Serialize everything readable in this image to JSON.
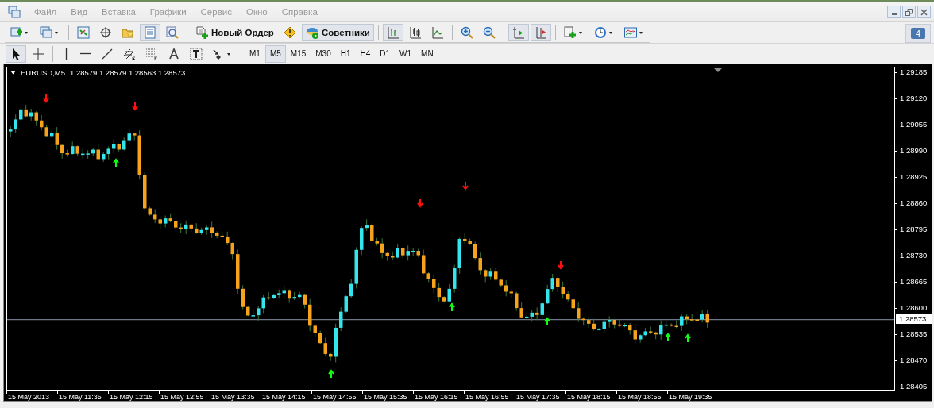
{
  "menu": [
    {
      "label": "Файл"
    },
    {
      "label": "Вид"
    },
    {
      "label": "Вставка"
    },
    {
      "label": "Графики"
    },
    {
      "label": "Сервис"
    },
    {
      "label": "Окно"
    },
    {
      "label": "Справка"
    }
  ],
  "notification_badge": {
    "count": "4"
  },
  "toolbar_main": [
    {
      "kind": "icon",
      "pressed": false
    },
    {
      "kind": "icon",
      "pressed": false
    },
    {
      "kind": "icon",
      "pressed": false
    },
    {
      "kind": "icon",
      "pressed": false
    },
    {
      "kind": "icon",
      "pressed": false
    },
    {
      "kind": "icon",
      "pressed": true
    },
    {
      "kind": "icon",
      "pressed": false
    },
    {
      "kind": "text",
      "label": "Новый Ордер",
      "pressed": false
    },
    {
      "kind": "icon",
      "pressed": false
    },
    {
      "kind": "text",
      "label": "Советники",
      "pressed": true
    },
    {
      "kind": "icon",
      "pressed": true
    },
    {
      "kind": "icon",
      "pressed": false
    },
    {
      "kind": "icon",
      "pressed": false
    },
    {
      "kind": "icon",
      "pressed": false
    },
    {
      "kind": "icon",
      "pressed": false
    },
    {
      "kind": "icon",
      "pressed": true
    },
    {
      "kind": "icon",
      "pressed": true
    },
    {
      "kind": "icon",
      "pressed": false
    },
    {
      "kind": "icon",
      "pressed": false
    },
    {
      "kind": "icon",
      "pressed": false
    }
  ],
  "toolbar_drawing": [
    {
      "pressed": true
    },
    {
      "pressed": false
    },
    {
      "pressed": false
    },
    {
      "pressed": false
    },
    {
      "pressed": false
    },
    {
      "pressed": false
    },
    {
      "pressed": false
    },
    {
      "pressed": false
    },
    {
      "pressed": false
    },
    {
      "pressed": false
    }
  ],
  "timeframes": [
    {
      "label": "M1",
      "selected": false
    },
    {
      "label": "M5",
      "selected": true
    },
    {
      "label": "M15",
      "selected": false
    },
    {
      "label": "M30",
      "selected": false
    },
    {
      "label": "H1",
      "selected": false
    },
    {
      "label": "H4",
      "selected": false
    },
    {
      "label": "D1",
      "selected": false
    },
    {
      "label": "W1",
      "selected": false
    },
    {
      "label": "MN",
      "selected": false
    }
  ],
  "chart": {
    "symbol": "EURUSD,M5",
    "quotes": "1.28579 1.28579 1.28563 1.28573",
    "price_labels": [
      "1.29185",
      "1.29120",
      "1.29055",
      "1.28990",
      "1.28925",
      "1.28860",
      "1.28795",
      "1.28730",
      "1.28665",
      "1.28600",
      "1.28535",
      "1.28470",
      "1.28405"
    ],
    "current_price": "1.28573",
    "time_labels": [
      "15 May 2013",
      "15 May 11:35",
      "15 May 12:15",
      "15 May 12:55",
      "15 May 13:35",
      "15 May 14:15",
      "15 May 14:55",
      "15 May 15:35",
      "15 May 16:15",
      "15 May 16:55",
      "15 May 17:35",
      "15 May 18:15",
      "15 May 18:55",
      "15 May 19:35"
    ]
  }
}
